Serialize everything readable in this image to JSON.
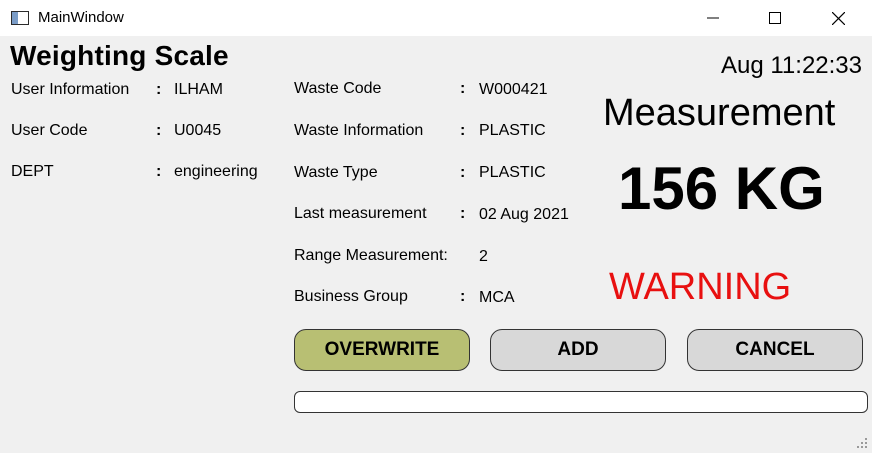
{
  "window": {
    "title": "MainWindow"
  },
  "header": {
    "title": "Weighting Scale",
    "clock": "Aug 11:22:33"
  },
  "user_info": [
    {
      "label": "User Information",
      "colon": ":",
      "value": "ILHAM"
    },
    {
      "label": "User Code",
      "colon": ":",
      "value": "U0045"
    },
    {
      "label": "DEPT",
      "colon": ":",
      "value": "engineering"
    }
  ],
  "waste_info": [
    {
      "label": "Waste Code",
      "colon": ":",
      "value": "W000421"
    },
    {
      "label": "Waste Information",
      "colon": ":",
      "value": "PLASTIC"
    },
    {
      "label": "Waste Type",
      "colon": ":",
      "value": "PLASTIC"
    },
    {
      "label": "Last measurement",
      "colon": ":",
      "value": "02 Aug 2021"
    },
    {
      "label": "Range Measurement:",
      "colon": "",
      "value": "2"
    },
    {
      "label": "Business Group",
      "colon": ":",
      "value": "MCA"
    }
  ],
  "measurement": {
    "title": "Measurement",
    "value": "156 KG",
    "warning": "WARNING",
    "warning_color": "#e81010"
  },
  "buttons": {
    "overwrite": "OVERWRITE",
    "add": "ADD",
    "cancel": "CANCEL",
    "overwrite_color": "#b8bf73"
  },
  "progress": {
    "value": 0
  }
}
